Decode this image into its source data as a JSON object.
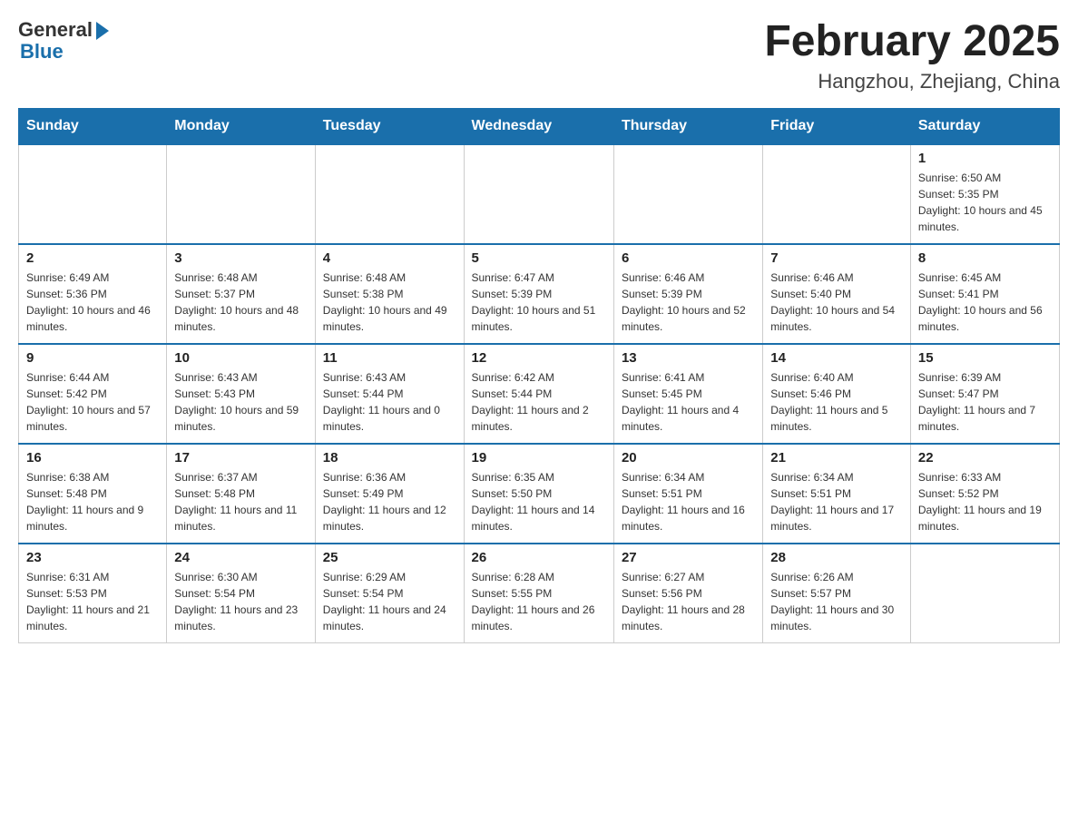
{
  "logo": {
    "general": "General",
    "blue": "Blue"
  },
  "header": {
    "month_year": "February 2025",
    "location": "Hangzhou, Zhejiang, China"
  },
  "days_of_week": [
    "Sunday",
    "Monday",
    "Tuesday",
    "Wednesday",
    "Thursday",
    "Friday",
    "Saturday"
  ],
  "weeks": [
    [
      {
        "day": "",
        "sunrise": "",
        "sunset": "",
        "daylight": ""
      },
      {
        "day": "",
        "sunrise": "",
        "sunset": "",
        "daylight": ""
      },
      {
        "day": "",
        "sunrise": "",
        "sunset": "",
        "daylight": ""
      },
      {
        "day": "",
        "sunrise": "",
        "sunset": "",
        "daylight": ""
      },
      {
        "day": "",
        "sunrise": "",
        "sunset": "",
        "daylight": ""
      },
      {
        "day": "",
        "sunrise": "",
        "sunset": "",
        "daylight": ""
      },
      {
        "day": "1",
        "sunrise": "Sunrise: 6:50 AM",
        "sunset": "Sunset: 5:35 PM",
        "daylight": "Daylight: 10 hours and 45 minutes."
      }
    ],
    [
      {
        "day": "2",
        "sunrise": "Sunrise: 6:49 AM",
        "sunset": "Sunset: 5:36 PM",
        "daylight": "Daylight: 10 hours and 46 minutes."
      },
      {
        "day": "3",
        "sunrise": "Sunrise: 6:48 AM",
        "sunset": "Sunset: 5:37 PM",
        "daylight": "Daylight: 10 hours and 48 minutes."
      },
      {
        "day": "4",
        "sunrise": "Sunrise: 6:48 AM",
        "sunset": "Sunset: 5:38 PM",
        "daylight": "Daylight: 10 hours and 49 minutes."
      },
      {
        "day": "5",
        "sunrise": "Sunrise: 6:47 AM",
        "sunset": "Sunset: 5:39 PM",
        "daylight": "Daylight: 10 hours and 51 minutes."
      },
      {
        "day": "6",
        "sunrise": "Sunrise: 6:46 AM",
        "sunset": "Sunset: 5:39 PM",
        "daylight": "Daylight: 10 hours and 52 minutes."
      },
      {
        "day": "7",
        "sunrise": "Sunrise: 6:46 AM",
        "sunset": "Sunset: 5:40 PM",
        "daylight": "Daylight: 10 hours and 54 minutes."
      },
      {
        "day": "8",
        "sunrise": "Sunrise: 6:45 AM",
        "sunset": "Sunset: 5:41 PM",
        "daylight": "Daylight: 10 hours and 56 minutes."
      }
    ],
    [
      {
        "day": "9",
        "sunrise": "Sunrise: 6:44 AM",
        "sunset": "Sunset: 5:42 PM",
        "daylight": "Daylight: 10 hours and 57 minutes."
      },
      {
        "day": "10",
        "sunrise": "Sunrise: 6:43 AM",
        "sunset": "Sunset: 5:43 PM",
        "daylight": "Daylight: 10 hours and 59 minutes."
      },
      {
        "day": "11",
        "sunrise": "Sunrise: 6:43 AM",
        "sunset": "Sunset: 5:44 PM",
        "daylight": "Daylight: 11 hours and 0 minutes."
      },
      {
        "day": "12",
        "sunrise": "Sunrise: 6:42 AM",
        "sunset": "Sunset: 5:44 PM",
        "daylight": "Daylight: 11 hours and 2 minutes."
      },
      {
        "day": "13",
        "sunrise": "Sunrise: 6:41 AM",
        "sunset": "Sunset: 5:45 PM",
        "daylight": "Daylight: 11 hours and 4 minutes."
      },
      {
        "day": "14",
        "sunrise": "Sunrise: 6:40 AM",
        "sunset": "Sunset: 5:46 PM",
        "daylight": "Daylight: 11 hours and 5 minutes."
      },
      {
        "day": "15",
        "sunrise": "Sunrise: 6:39 AM",
        "sunset": "Sunset: 5:47 PM",
        "daylight": "Daylight: 11 hours and 7 minutes."
      }
    ],
    [
      {
        "day": "16",
        "sunrise": "Sunrise: 6:38 AM",
        "sunset": "Sunset: 5:48 PM",
        "daylight": "Daylight: 11 hours and 9 minutes."
      },
      {
        "day": "17",
        "sunrise": "Sunrise: 6:37 AM",
        "sunset": "Sunset: 5:48 PM",
        "daylight": "Daylight: 11 hours and 11 minutes."
      },
      {
        "day": "18",
        "sunrise": "Sunrise: 6:36 AM",
        "sunset": "Sunset: 5:49 PM",
        "daylight": "Daylight: 11 hours and 12 minutes."
      },
      {
        "day": "19",
        "sunrise": "Sunrise: 6:35 AM",
        "sunset": "Sunset: 5:50 PM",
        "daylight": "Daylight: 11 hours and 14 minutes."
      },
      {
        "day": "20",
        "sunrise": "Sunrise: 6:34 AM",
        "sunset": "Sunset: 5:51 PM",
        "daylight": "Daylight: 11 hours and 16 minutes."
      },
      {
        "day": "21",
        "sunrise": "Sunrise: 6:34 AM",
        "sunset": "Sunset: 5:51 PM",
        "daylight": "Daylight: 11 hours and 17 minutes."
      },
      {
        "day": "22",
        "sunrise": "Sunrise: 6:33 AM",
        "sunset": "Sunset: 5:52 PM",
        "daylight": "Daylight: 11 hours and 19 minutes."
      }
    ],
    [
      {
        "day": "23",
        "sunrise": "Sunrise: 6:31 AM",
        "sunset": "Sunset: 5:53 PM",
        "daylight": "Daylight: 11 hours and 21 minutes."
      },
      {
        "day": "24",
        "sunrise": "Sunrise: 6:30 AM",
        "sunset": "Sunset: 5:54 PM",
        "daylight": "Daylight: 11 hours and 23 minutes."
      },
      {
        "day": "25",
        "sunrise": "Sunrise: 6:29 AM",
        "sunset": "Sunset: 5:54 PM",
        "daylight": "Daylight: 11 hours and 24 minutes."
      },
      {
        "day": "26",
        "sunrise": "Sunrise: 6:28 AM",
        "sunset": "Sunset: 5:55 PM",
        "daylight": "Daylight: 11 hours and 26 minutes."
      },
      {
        "day": "27",
        "sunrise": "Sunrise: 6:27 AM",
        "sunset": "Sunset: 5:56 PM",
        "daylight": "Daylight: 11 hours and 28 minutes."
      },
      {
        "day": "28",
        "sunrise": "Sunrise: 6:26 AM",
        "sunset": "Sunset: 5:57 PM",
        "daylight": "Daylight: 11 hours and 30 minutes."
      },
      {
        "day": "",
        "sunrise": "",
        "sunset": "",
        "daylight": ""
      }
    ]
  ]
}
